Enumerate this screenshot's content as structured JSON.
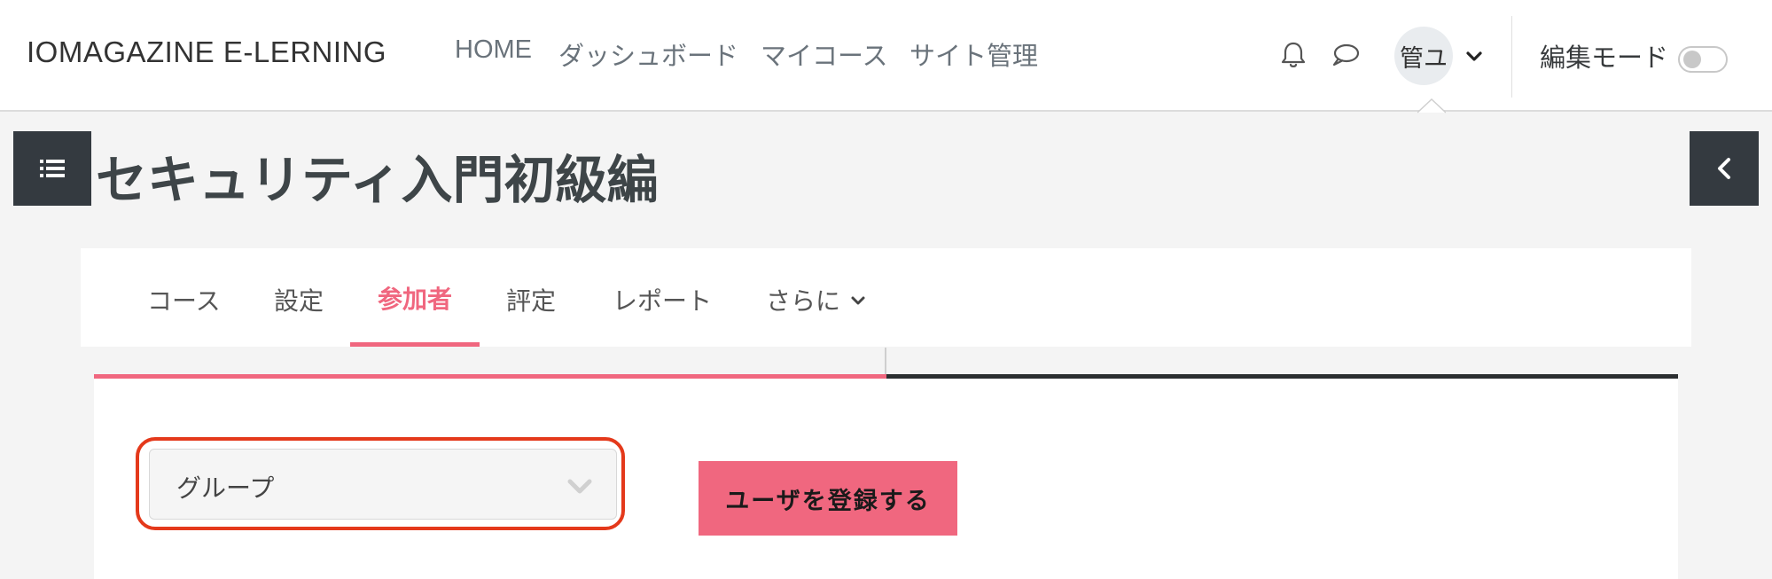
{
  "navbar": {
    "brand": "IOMAGAZINE E-LERNING",
    "links": [
      "HOME",
      "ダッシュボード",
      "マイコース",
      "サイト管理"
    ],
    "user_initials": "管ユ",
    "edit_mode_label": "編集モード",
    "edit_mode_on": false
  },
  "page": {
    "title": "セキュリティ入門初級編"
  },
  "secondary_nav": {
    "items": [
      "コース",
      "設定",
      "参加者",
      "評定",
      "レポート",
      "さらに"
    ],
    "active": "参加者"
  },
  "content": {
    "group_select_value": "グループ",
    "enrol_button_label": "ユーザを登録する"
  },
  "colors": {
    "accent": "#f0677f",
    "dark": "#343a40",
    "highlight": "#e4391b"
  }
}
